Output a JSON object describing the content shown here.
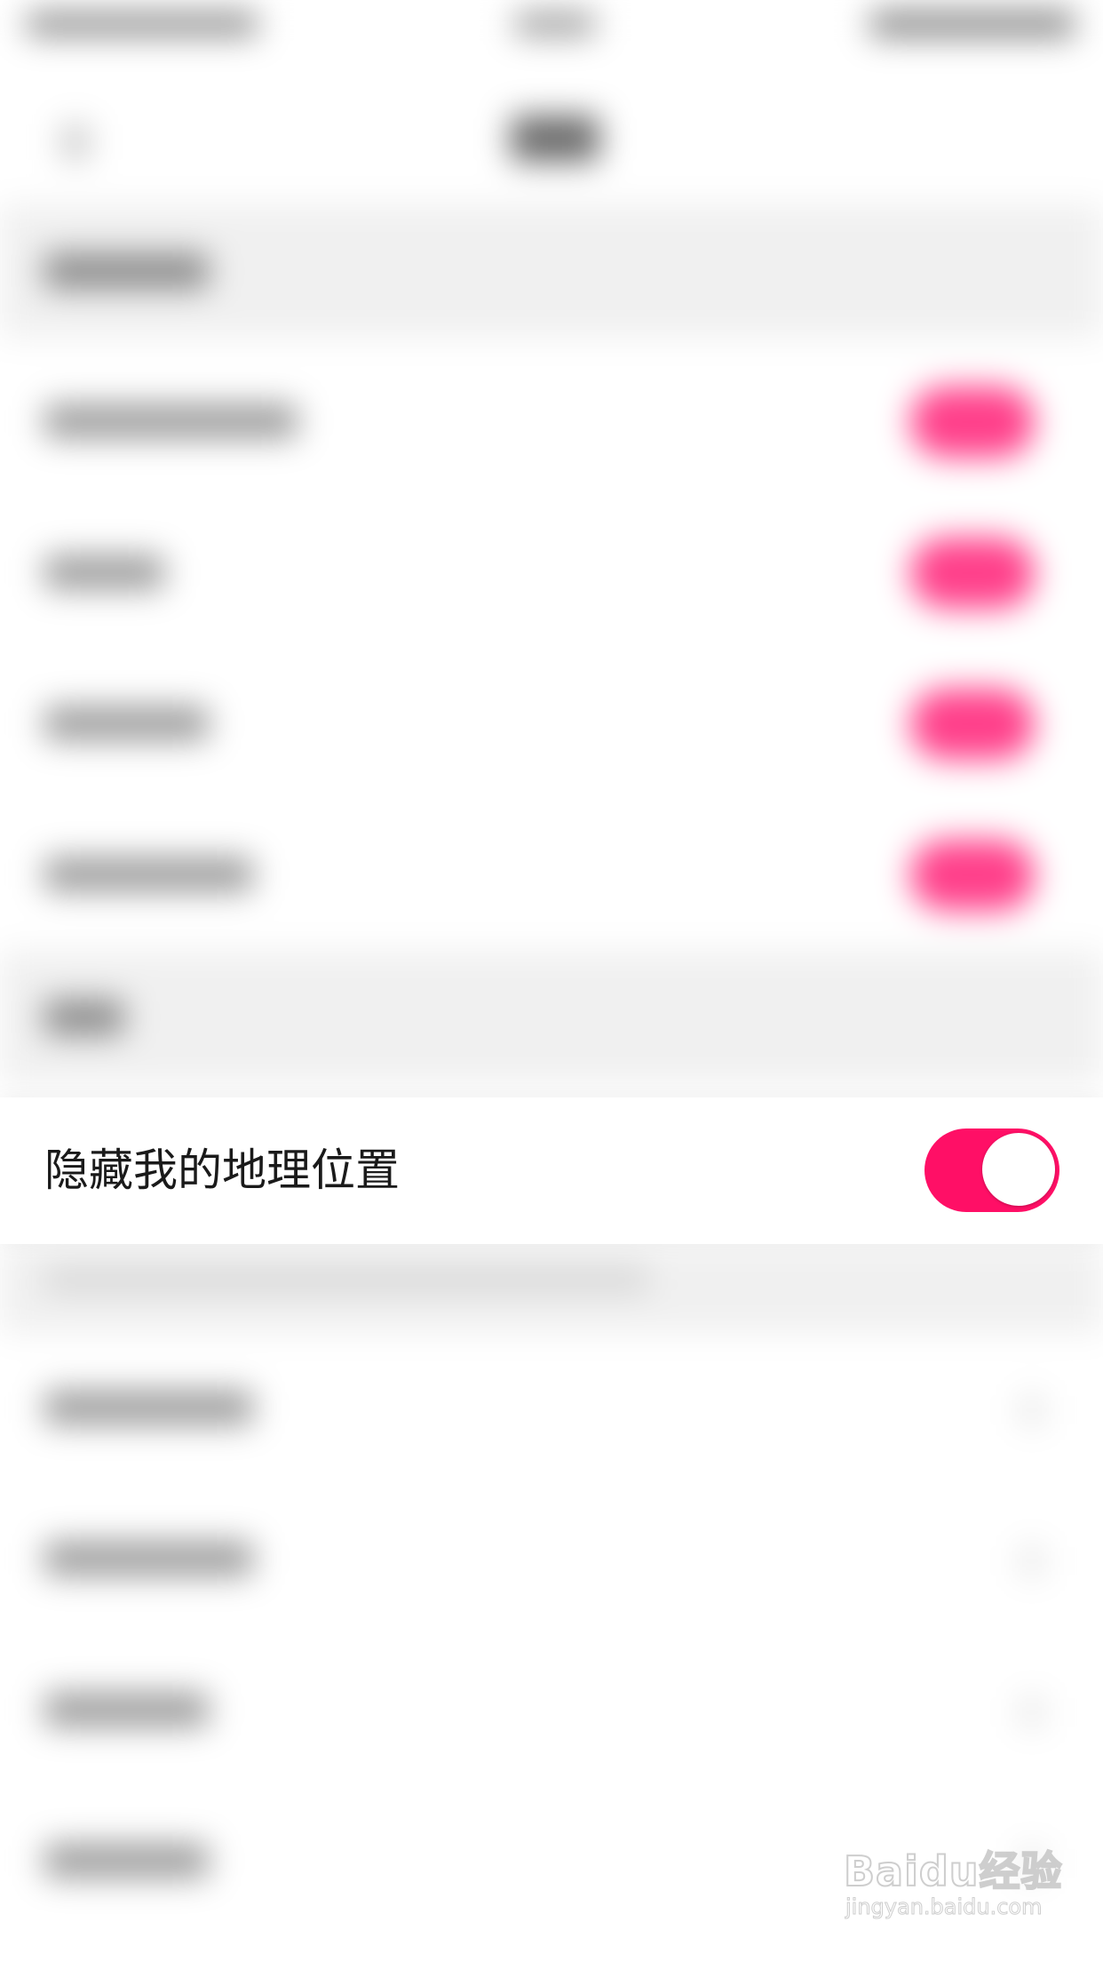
{
  "focused_setting": {
    "label": "隐藏我的地理位置",
    "enabled": true
  },
  "colors": {
    "accent": "#ff0f66",
    "background": "#ffffff",
    "section_background": "#f0f0f0",
    "text": "#1a1a1a"
  },
  "watermark": {
    "brand": "Baidu经验",
    "url": "jingyan.baidu.com"
  }
}
